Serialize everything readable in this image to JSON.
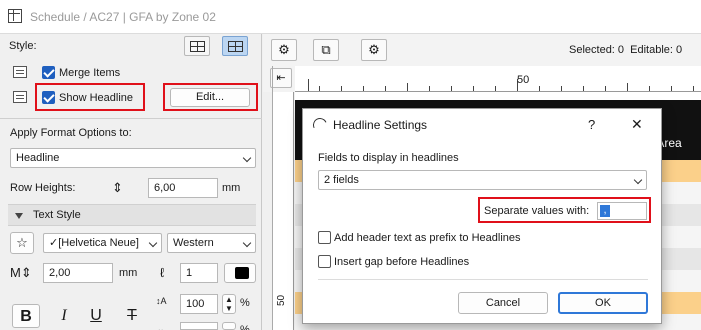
{
  "window": {
    "title": "Schedule / AC27 | GFA by Zone 02"
  },
  "style_panel": {
    "style_label": "Style:",
    "merge_items_label": "Merge Items",
    "merge_items_checked": true,
    "show_headline_label": "Show Headline",
    "show_headline_checked": true,
    "edit_button_label": "Edit...",
    "apply_format_label": "Apply Format Options to:",
    "apply_format_value": "Headline",
    "row_heights_label": "Row Heights:",
    "row_heights_value": "6,00",
    "row_heights_unit": "mm",
    "text_style_header": "Text Style",
    "font_value": "[Helvetica Neue]",
    "script_value": "Western",
    "font_size_value": "2,00",
    "font_size_unit": "mm",
    "pen_value": "1",
    "scale_value": "100",
    "scale_unit": "%",
    "scale2_value": "100",
    "scale2_unit": "%",
    "bold_glyph": "B",
    "italic_glyph": "I",
    "underline_glyph": "U",
    "strike_glyph": "T",
    "star_glyph": "☆"
  },
  "toolbar": {
    "status_text": "Selected: 0  Editable: 0"
  },
  "ruler": {
    "labels": [
      "50"
    ]
  },
  "vruler": {
    "labels": [
      "50"
    ]
  },
  "table_peek": {
    "header_text": "d Area"
  },
  "dialog": {
    "title": "Headline Settings",
    "help_label": "?",
    "close_label": "✕",
    "fields_label": "Fields to display in headlines",
    "fields_value": "2 fields",
    "separate_label": "Separate values with:",
    "separate_value": ",",
    "add_header_label": "Add header text as prefix to Headlines",
    "add_header_checked": false,
    "insert_gap_label": "Insert gap before Headlines",
    "insert_gap_checked": false,
    "cancel_label": "Cancel",
    "ok_label": "OK"
  },
  "colors": {
    "accent": "#1f5fbf",
    "highlight_red": "#e0101a",
    "table_header_dark": "#111111",
    "table_row_orange": "#fbd08a",
    "ok_border": "#2f78d8"
  }
}
